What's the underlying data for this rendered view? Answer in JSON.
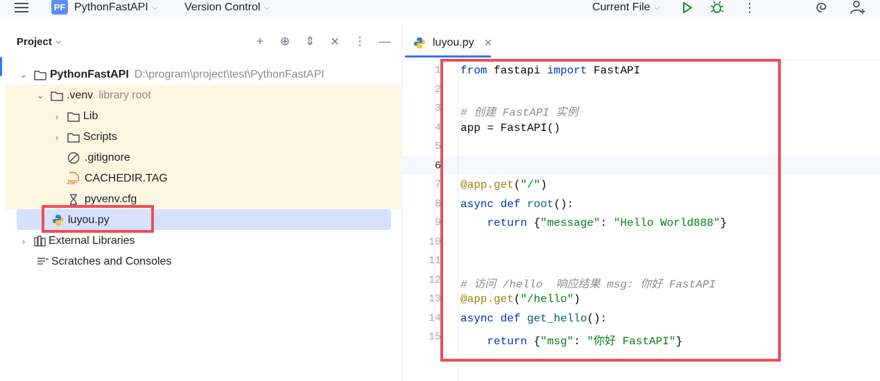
{
  "toolbar": {
    "project_badge": "PF",
    "project_name": "PythonFastAPI",
    "vcs": "Version Control",
    "run_config": "Current File"
  },
  "project_pane": {
    "title": "Project",
    "tree": [
      {
        "label": "PythonFastAPI",
        "hint": "D:\\program\\project\\test\\PythonFastAPI"
      },
      {
        "label": ".venv",
        "hint": "library root"
      },
      {
        "label": "Lib"
      },
      {
        "label": "Scripts"
      },
      {
        "label": ".gitignore"
      },
      {
        "label": "CACHEDIR.TAG"
      },
      {
        "label": "pyvenv.cfg"
      },
      {
        "label": "luyou.py"
      },
      {
        "label": "External Libraries"
      },
      {
        "label": "Scratches and Consoles"
      }
    ],
    "jsp_badge": "JSP"
  },
  "editor": {
    "tab_label": "luyou.py",
    "line_numbers": [
      "1",
      "2",
      "3",
      "4",
      "5",
      "6",
      "7",
      "8",
      "9",
      "10",
      "11",
      "12",
      "13",
      "14",
      "15"
    ],
    "code": {
      "l1_kw1": "from",
      "l1_mod": " fastapi ",
      "l1_kw2": "import",
      "l1_name": " FastAPI",
      "l3_comment": "# 创建 FastAPI 实例",
      "l4_text": "app = FastAPI()",
      "l7_dec": "@app.get",
      "l7_open": "(",
      "l7_str": "\"/\"",
      "l7_close": ")",
      "l8_kw1": "async",
      "l8_sp": " ",
      "l8_kw2": "def",
      "l8_fn": " root",
      "l8_rest": "():",
      "l9_ind": "    ",
      "l9_kw": "return",
      "l9_b1": " {",
      "l9_s1": "\"message\"",
      "l9_colon": ": ",
      "l9_s2": "\"Hello World888\"",
      "l9_b2": "}",
      "l12_comment": "# 访问 /hello  响应结果 msg: 你好 FastAPI",
      "l13_dec": "@app.get",
      "l13_open": "(",
      "l13_str": "\"/hello\"",
      "l13_close": ")",
      "l14_kw1": "async",
      "l14_sp": " ",
      "l14_kw2": "def",
      "l14_fn": " get_hello",
      "l14_rest": "():",
      "l15_ind": "    ",
      "l15_kw": "return",
      "l15_b1": " {",
      "l15_s1": "\"msg\"",
      "l15_colon": ": ",
      "l15_s2": "\"你好 FastAPI\"",
      "l15_b2": "}"
    }
  },
  "colors": {
    "accent": "#3574f0",
    "highlight_box": "#ef4d55",
    "selection": "#d5e1ff",
    "excluded_band": "#fdf6e1"
  }
}
